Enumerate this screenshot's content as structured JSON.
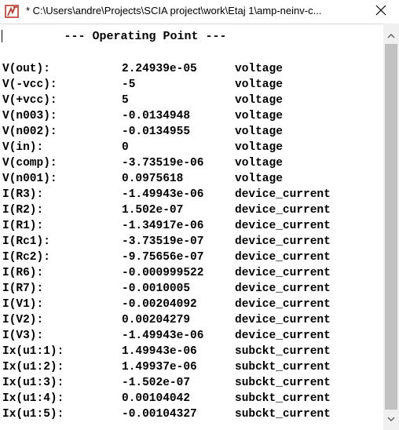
{
  "window": {
    "title": "* C:\\Users\\andre\\Projects\\SCIA project\\work\\Etaj 1\\amp-neinv-c...",
    "close_glyph": "✕"
  },
  "output": {
    "header": "--- Operating Point ---",
    "rows": [
      {
        "name": "V(out):",
        "value": "2.24939e-05",
        "kind": "voltage"
      },
      {
        "name": "V(-vcc):",
        "value": "-5",
        "kind": "voltage"
      },
      {
        "name": "V(+vcc):",
        "value": "5",
        "kind": "voltage"
      },
      {
        "name": "V(n003):",
        "value": "-0.0134948",
        "kind": "voltage"
      },
      {
        "name": "V(n002):",
        "value": "-0.0134955",
        "kind": "voltage"
      },
      {
        "name": "V(in):",
        "value": "0",
        "kind": "voltage"
      },
      {
        "name": "V(comp):",
        "value": "-3.73519e-06",
        "kind": "voltage"
      },
      {
        "name": "V(n001):",
        "value": "0.0975618",
        "kind": "voltage"
      },
      {
        "name": "I(R3):",
        "value": "-1.49943e-06",
        "kind": "device_current"
      },
      {
        "name": "I(R2):",
        "value": "1.502e-07",
        "kind": "device_current"
      },
      {
        "name": "I(R1):",
        "value": "-1.34917e-06",
        "kind": "device_current"
      },
      {
        "name": "I(Rc1):",
        "value": "-3.73519e-07",
        "kind": "device_current"
      },
      {
        "name": "I(Rc2):",
        "value": "-9.75656e-07",
        "kind": "device_current"
      },
      {
        "name": "I(R6):",
        "value": "-0.000999522",
        "kind": "device_current"
      },
      {
        "name": "I(R7):",
        "value": "-0.0010005",
        "kind": "device_current"
      },
      {
        "name": "I(V1):",
        "value": "-0.00204092",
        "kind": "device_current"
      },
      {
        "name": "I(V2):",
        "value": "0.00204279",
        "kind": "device_current"
      },
      {
        "name": "I(V3):",
        "value": "-1.49943e-06",
        "kind": "device_current"
      },
      {
        "name": "Ix(u1:1):",
        "value": "1.49943e-06",
        "kind": "subckt_current"
      },
      {
        "name": "Ix(u1:2):",
        "value": "1.49937e-06",
        "kind": "subckt_current"
      },
      {
        "name": "Ix(u1:3):",
        "value": "-1.502e-07",
        "kind": "subckt_current"
      },
      {
        "name": "Ix(u1:4):",
        "value": "0.00104042",
        "kind": "subckt_current"
      },
      {
        "name": "Ix(u1:5):",
        "value": "-0.00104327",
        "kind": "subckt_current"
      }
    ]
  },
  "icons": {
    "app": "ltspice-app-icon",
    "close": "close-icon",
    "scroll_up": "chevron-up-icon",
    "scroll_down": "chevron-down-icon"
  },
  "colors": {
    "icon_red": "#c0392b",
    "scroll_track": "#f0f0f0",
    "scroll_thumb": "#c1c1c1"
  }
}
